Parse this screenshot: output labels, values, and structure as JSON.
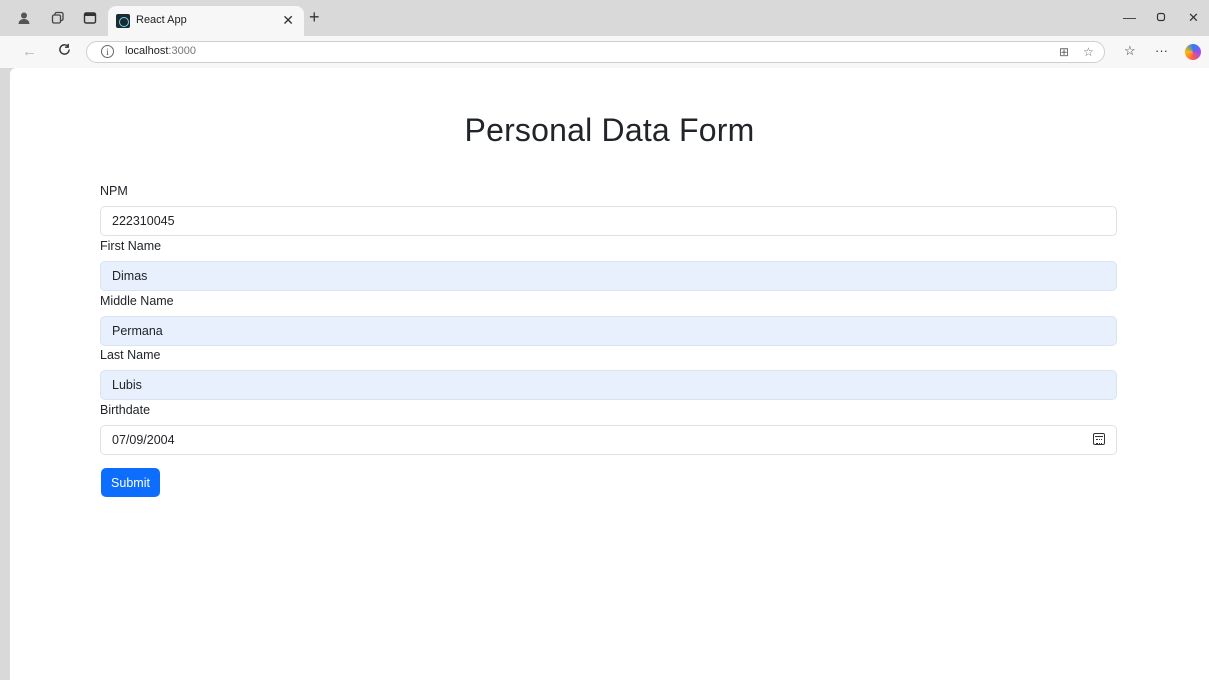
{
  "browser": {
    "tab_title": "React App",
    "url_host": "localhost",
    "url_port": ":3000",
    "icons": [
      "profile-icon",
      "workspaces-icon",
      "tab-actions-icon",
      "react-favicon",
      "tab-close-icon",
      "new-tab-icon",
      "minimize-icon",
      "restore-icon",
      "window-close-icon",
      "back-icon",
      "refresh-icon",
      "site-info-icon",
      "split-screen-icon",
      "favorite-star-icon",
      "favorites-icon",
      "more-icon",
      "copilot-icon"
    ]
  },
  "form": {
    "title": "Personal Data Form",
    "fields": [
      {
        "label": "NPM",
        "value": "222310045"
      },
      {
        "label": "First Name",
        "value": "Dimas"
      },
      {
        "label": "Middle Name",
        "value": "Permana"
      },
      {
        "label": "Last Name",
        "value": "Lubis"
      },
      {
        "label": "Birthdate",
        "value": "07/09/2004"
      }
    ],
    "submit_label": "Submit",
    "colors": {
      "primary": "#0d6efd",
      "autofill_bg": "#e8f0fe",
      "text": "#212529"
    }
  }
}
